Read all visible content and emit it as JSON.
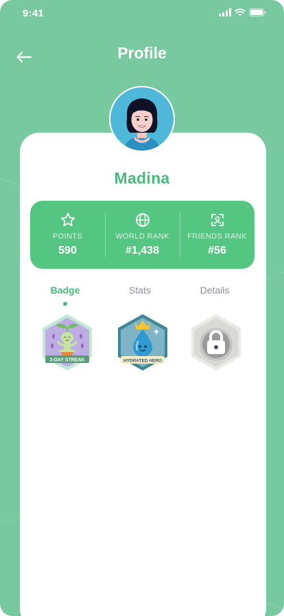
{
  "status_bar": {
    "time": "9:41"
  },
  "header": {
    "title": "Profile"
  },
  "user": {
    "name": "Madina"
  },
  "stats": [
    {
      "icon": "star-icon",
      "label": "POINTS",
      "value": "590"
    },
    {
      "icon": "globe-icon",
      "label": "WORLD RANK",
      "value": "#1,438"
    },
    {
      "icon": "friends-icon",
      "label": "FRIENDS RANK",
      "value": "#56"
    }
  ],
  "tabs": [
    {
      "label": "Badge",
      "active": true
    },
    {
      "label": "Stats",
      "active": false
    },
    {
      "label": "Details",
      "active": false
    }
  ],
  "badges": [
    {
      "icon": "sprout-meditating-icon",
      "label": "3-DAY STREAK",
      "locked": false
    },
    {
      "icon": "water-drop-crown-icon",
      "label": "HYDRATED HERO",
      "locked": false
    },
    {
      "icon": "lock-icon",
      "label": "",
      "locked": true
    }
  ],
  "colors": {
    "background": "#79c9a0",
    "accent": "#4cb97f",
    "stats_bar": "#55c582",
    "card": "#ffffff",
    "inactive_tab": "#8a8f96"
  }
}
